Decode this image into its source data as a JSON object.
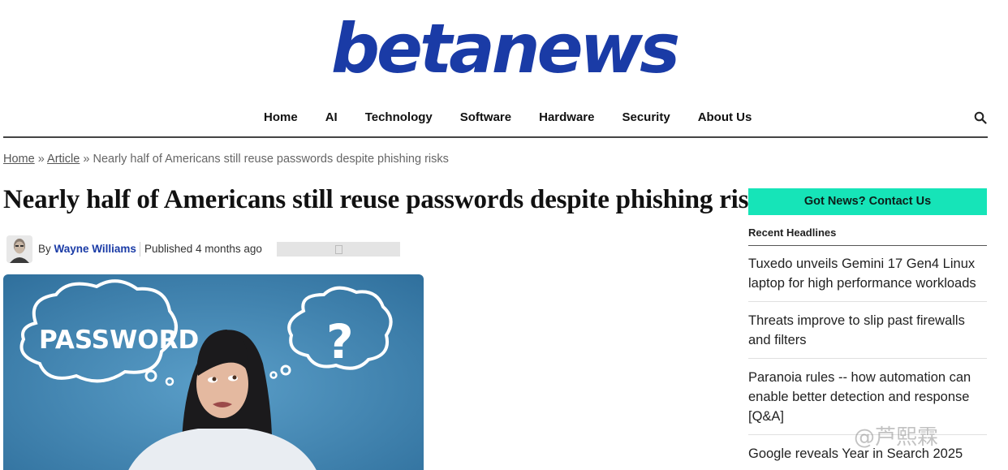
{
  "site": {
    "logo_text": "betanews",
    "brand_color": "#1a3ba6"
  },
  "nav": {
    "items": [
      {
        "label": "Home"
      },
      {
        "label": "AI"
      },
      {
        "label": "Technology"
      },
      {
        "label": "Software"
      },
      {
        "label": "Hardware"
      },
      {
        "label": "Security"
      },
      {
        "label": "About Us"
      }
    ],
    "search_icon": "search-icon"
  },
  "breadcrumb": {
    "home": "Home",
    "sep": "»",
    "article": "Article",
    "current": "Nearly half of Americans still reuse passwords despite phishing risks"
  },
  "article": {
    "title": "Nearly half of Americans still reuse passwords despite phishing risks",
    "by_prefix": "By",
    "author": "Wayne Williams",
    "published": "Published 4 months ago",
    "hero_image": {
      "bubble_left_text": "PASSWORD",
      "bubble_right_text": "?"
    }
  },
  "sidebar": {
    "contact_button": "Got News? Contact Us",
    "contact_color": "#16e4b8",
    "recent_heading": "Recent Headlines",
    "headlines": [
      {
        "text": "Tuxedo unveils Gemini 17 Gen4 Linux laptop for high performance workloads"
      },
      {
        "text": "Threats improve to slip past firewalls and filters"
      },
      {
        "text": "Paranoia rules -- how automation can enable better detection and response [Q&A]"
      },
      {
        "text": "Google reveals Year in Search 2025"
      }
    ]
  },
  "watermark": {
    "text": "@芦熙霖"
  }
}
